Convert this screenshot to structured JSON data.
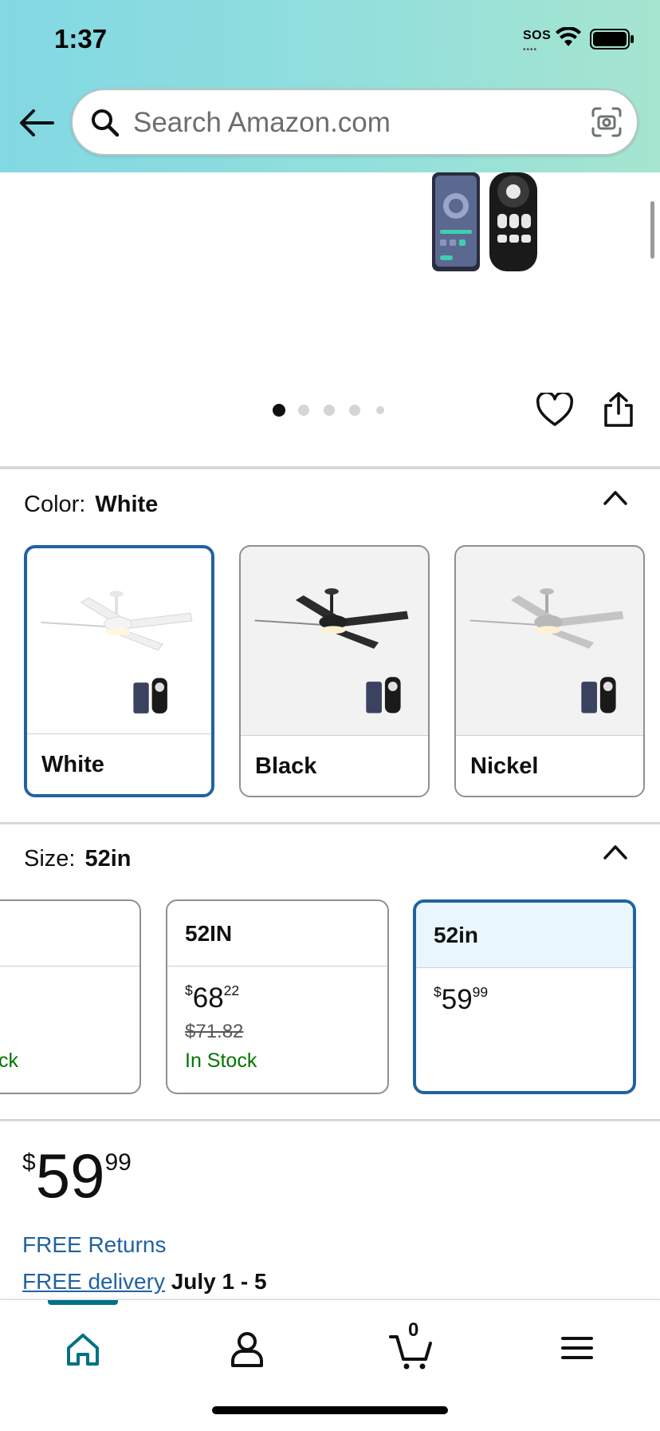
{
  "status_bar": {
    "time": "1:37",
    "sos": "SOS"
  },
  "search": {
    "placeholder": "Search Amazon.com"
  },
  "carousel": {
    "dot_count": 5,
    "active_index": 0
  },
  "color_section": {
    "label": "Color:",
    "selected": "White",
    "options": [
      {
        "label": "White",
        "selected": true
      },
      {
        "label": "Black",
        "selected": false
      },
      {
        "label": "Nickel",
        "selected": false
      }
    ]
  },
  "size_section": {
    "label": "Size:",
    "selected": "52in",
    "partial_card": {
      "status_fragment": "ck"
    },
    "options": [
      {
        "title": "52IN",
        "price_symbol": "$",
        "price_whole": "68",
        "price_cents": "22",
        "list_price": "$71.82",
        "availability": "In Stock"
      },
      {
        "title": "52in",
        "price_symbol": "$",
        "price_whole": "59",
        "price_cents": "99",
        "selected": true
      }
    ]
  },
  "price_block": {
    "symbol": "$",
    "whole": "59",
    "cents": "99",
    "free_returns": "FREE Returns",
    "delivery_link": "FREE delivery",
    "delivery_dates": "July 1 - 5"
  },
  "bottom_nav": {
    "cart_count": "0"
  },
  "colors": {
    "accent_blue": "#2162a1",
    "teal": "#007185",
    "in_stock_green": "#007600"
  }
}
